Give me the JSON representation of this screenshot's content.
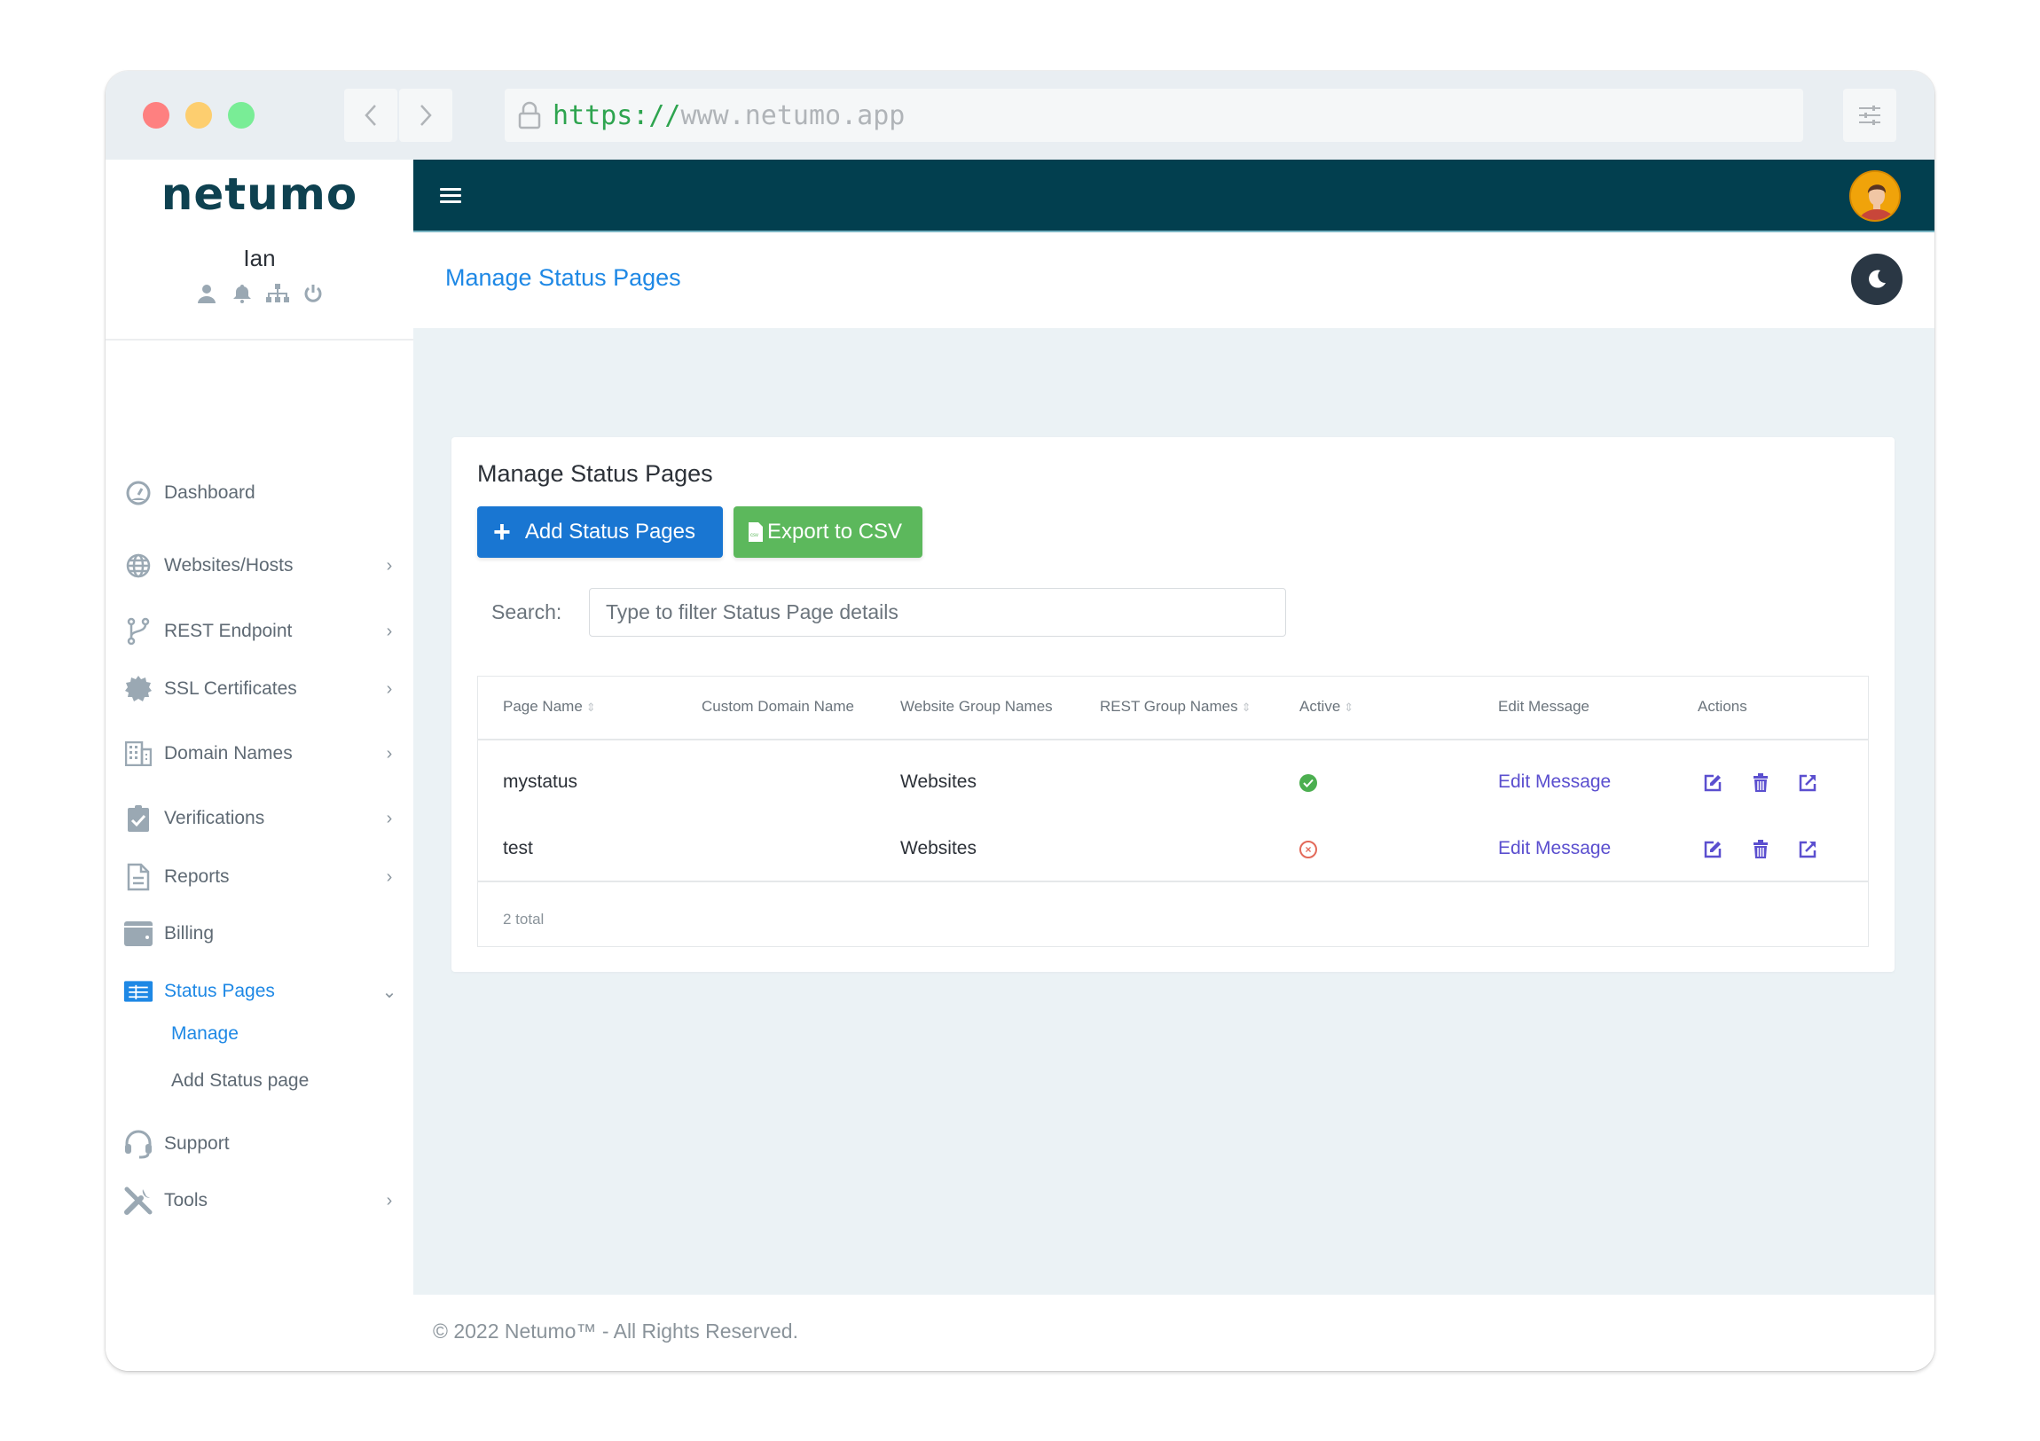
{
  "browser": {
    "url_scheme": "https://",
    "url_host": "www.netumo.app",
    "back_icon": "chevron-left-icon",
    "forward_icon": "chevron-right-icon",
    "settings_icon": "sliders-icon"
  },
  "sidebar": {
    "brand": "netumo",
    "user_name": "Ian",
    "user_icons": [
      "user-icon",
      "bell-icon",
      "sitemap-icon",
      "power-icon"
    ],
    "items": [
      {
        "label": "Dashboard",
        "icon": "dashboard-gauge-icon",
        "has_children": false
      },
      {
        "label": "Websites/Hosts",
        "icon": "globe-icon",
        "has_children": true
      },
      {
        "label": "REST Endpoint",
        "icon": "code-branch-icon",
        "has_children": true
      },
      {
        "label": "SSL Certificates",
        "icon": "certificate-icon",
        "has_children": true
      },
      {
        "label": "Domain Names",
        "icon": "building-icon",
        "has_children": true
      },
      {
        "label": "Verifications",
        "icon": "clipboard-check-icon",
        "has_children": true
      },
      {
        "label": "Reports",
        "icon": "file-document-icon",
        "has_children": true
      },
      {
        "label": "Billing",
        "icon": "wallet-icon",
        "has_children": false
      },
      {
        "label": "Status Pages",
        "icon": "list-alt-icon",
        "has_children": true,
        "expanded": true,
        "active": true
      },
      {
        "label": "Support",
        "icon": "headset-icon",
        "has_children": false
      },
      {
        "label": "Tools",
        "icon": "tools-icon",
        "has_children": true
      }
    ],
    "sub_items": [
      {
        "label": "Manage",
        "active": true
      },
      {
        "label": "Add Status page",
        "active": false
      }
    ]
  },
  "topbar": {
    "menu_icon": "hamburger-menu-icon",
    "avatar_icon": "user-avatar-icon"
  },
  "breadcrumb": {
    "title": "Manage Status Pages",
    "dark_mode_icon": "moon-icon"
  },
  "card": {
    "title": "Manage Status Pages",
    "add_button": "Add Status Pages",
    "export_button": "Export to CSV",
    "search_label": "Search:",
    "search_placeholder": "Type to filter Status Page details",
    "search_value": ""
  },
  "table": {
    "columns": [
      {
        "label": "Page Name",
        "sortable": true
      },
      {
        "label": "Custom Domain Name",
        "sortable": false
      },
      {
        "label": "Website Group Names",
        "sortable": false
      },
      {
        "label": "REST Group Names",
        "sortable": true
      },
      {
        "label": "Active",
        "sortable": true
      },
      {
        "label": "Edit Message",
        "sortable": false
      },
      {
        "label": "Actions",
        "sortable": false
      }
    ],
    "rows": [
      {
        "page_name": "mystatus",
        "custom_domain": "",
        "website_groups": "Websites",
        "rest_groups": "",
        "active": true,
        "edit_message": "Edit Message",
        "actions": [
          "edit-icon",
          "trash-icon",
          "external-link-icon"
        ]
      },
      {
        "page_name": "test",
        "custom_domain": "",
        "website_groups": "Websites",
        "rest_groups": "",
        "active": false,
        "edit_message": "Edit Message",
        "actions": [
          "edit-icon",
          "trash-icon",
          "external-link-icon"
        ]
      }
    ],
    "total": "2 total"
  },
  "footer": {
    "text": "© 2022 Netumo™ - All Rights Reserved."
  },
  "colors": {
    "topbar": "#023f4f",
    "accent_blue": "#1e88e5",
    "add_button": "#1976d2",
    "export_button": "#5cb85c",
    "action_purple": "#5b4fcf",
    "active_green": "#4caf50",
    "inactive_red": "#e36a5a",
    "brand_orange": "#e88b1a"
  }
}
